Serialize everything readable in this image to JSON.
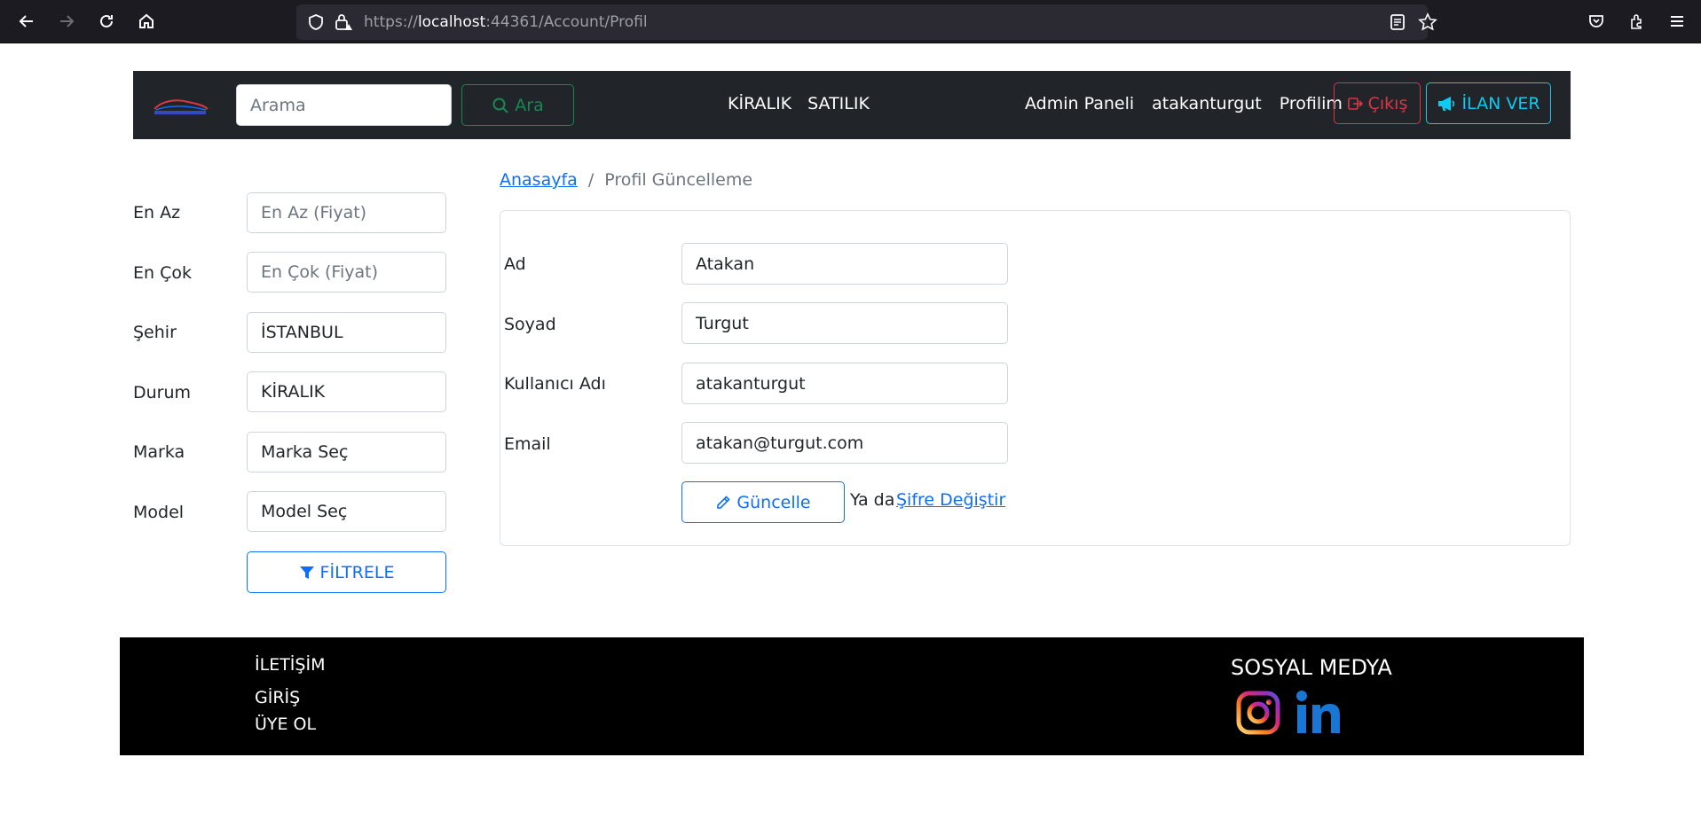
{
  "browser": {
    "url_prefix": "https://",
    "url_host": "localhost",
    "url_rest": ":44361/Account/Profil"
  },
  "navbar": {
    "search_placeholder": "Arama",
    "search_button": "Ara",
    "links_center": [
      "KİRALIK",
      "SATILIK"
    ],
    "links_right": [
      "Admin Paneli",
      "atakanturgut",
      "Profilim"
    ],
    "logout_button": "Çıkış",
    "ilan_button": "İLAN VER"
  },
  "filters": {
    "items": [
      {
        "label": "En Az",
        "value": "En Az (Fiyat)",
        "placeholder": true
      },
      {
        "label": "En Çok",
        "value": "En Çok (Fiyat)",
        "placeholder": true
      },
      {
        "label": "Şehir",
        "value": "İSTANBUL",
        "placeholder": false
      },
      {
        "label": "Durum",
        "value": "KİRALIK",
        "placeholder": false
      },
      {
        "label": "Marka",
        "value": "Marka Seç",
        "placeholder": false
      },
      {
        "label": "Model",
        "value": "Model Seç",
        "placeholder": false
      }
    ],
    "filter_button": "FİLTRELE"
  },
  "breadcrumb": {
    "home": "Anasayfa",
    "separator": "/",
    "current": "Profil Güncelleme"
  },
  "profile_form": {
    "fields": [
      {
        "label": "Ad",
        "value": "Atakan"
      },
      {
        "label": "Soyad",
        "value": "Turgut"
      },
      {
        "label": "Kullanıcı Adı",
        "value": "atakanturgut"
      },
      {
        "label": "Email",
        "value": "atakan@turgut.com"
      }
    ],
    "update_button": "Güncelle",
    "or_text": "Ya da",
    "change_password_link": "Şifre Değiştir"
  },
  "footer": {
    "links": [
      "İLETİŞİM",
      "GİRİŞ",
      "ÜYE OL"
    ],
    "social_title": "SOSYAL MEDYA"
  },
  "colors": {
    "primary": "#0d6efd",
    "success": "#198754",
    "danger": "#dc3545",
    "info": "#0dcaf0",
    "navbar_bg": "#212529"
  }
}
